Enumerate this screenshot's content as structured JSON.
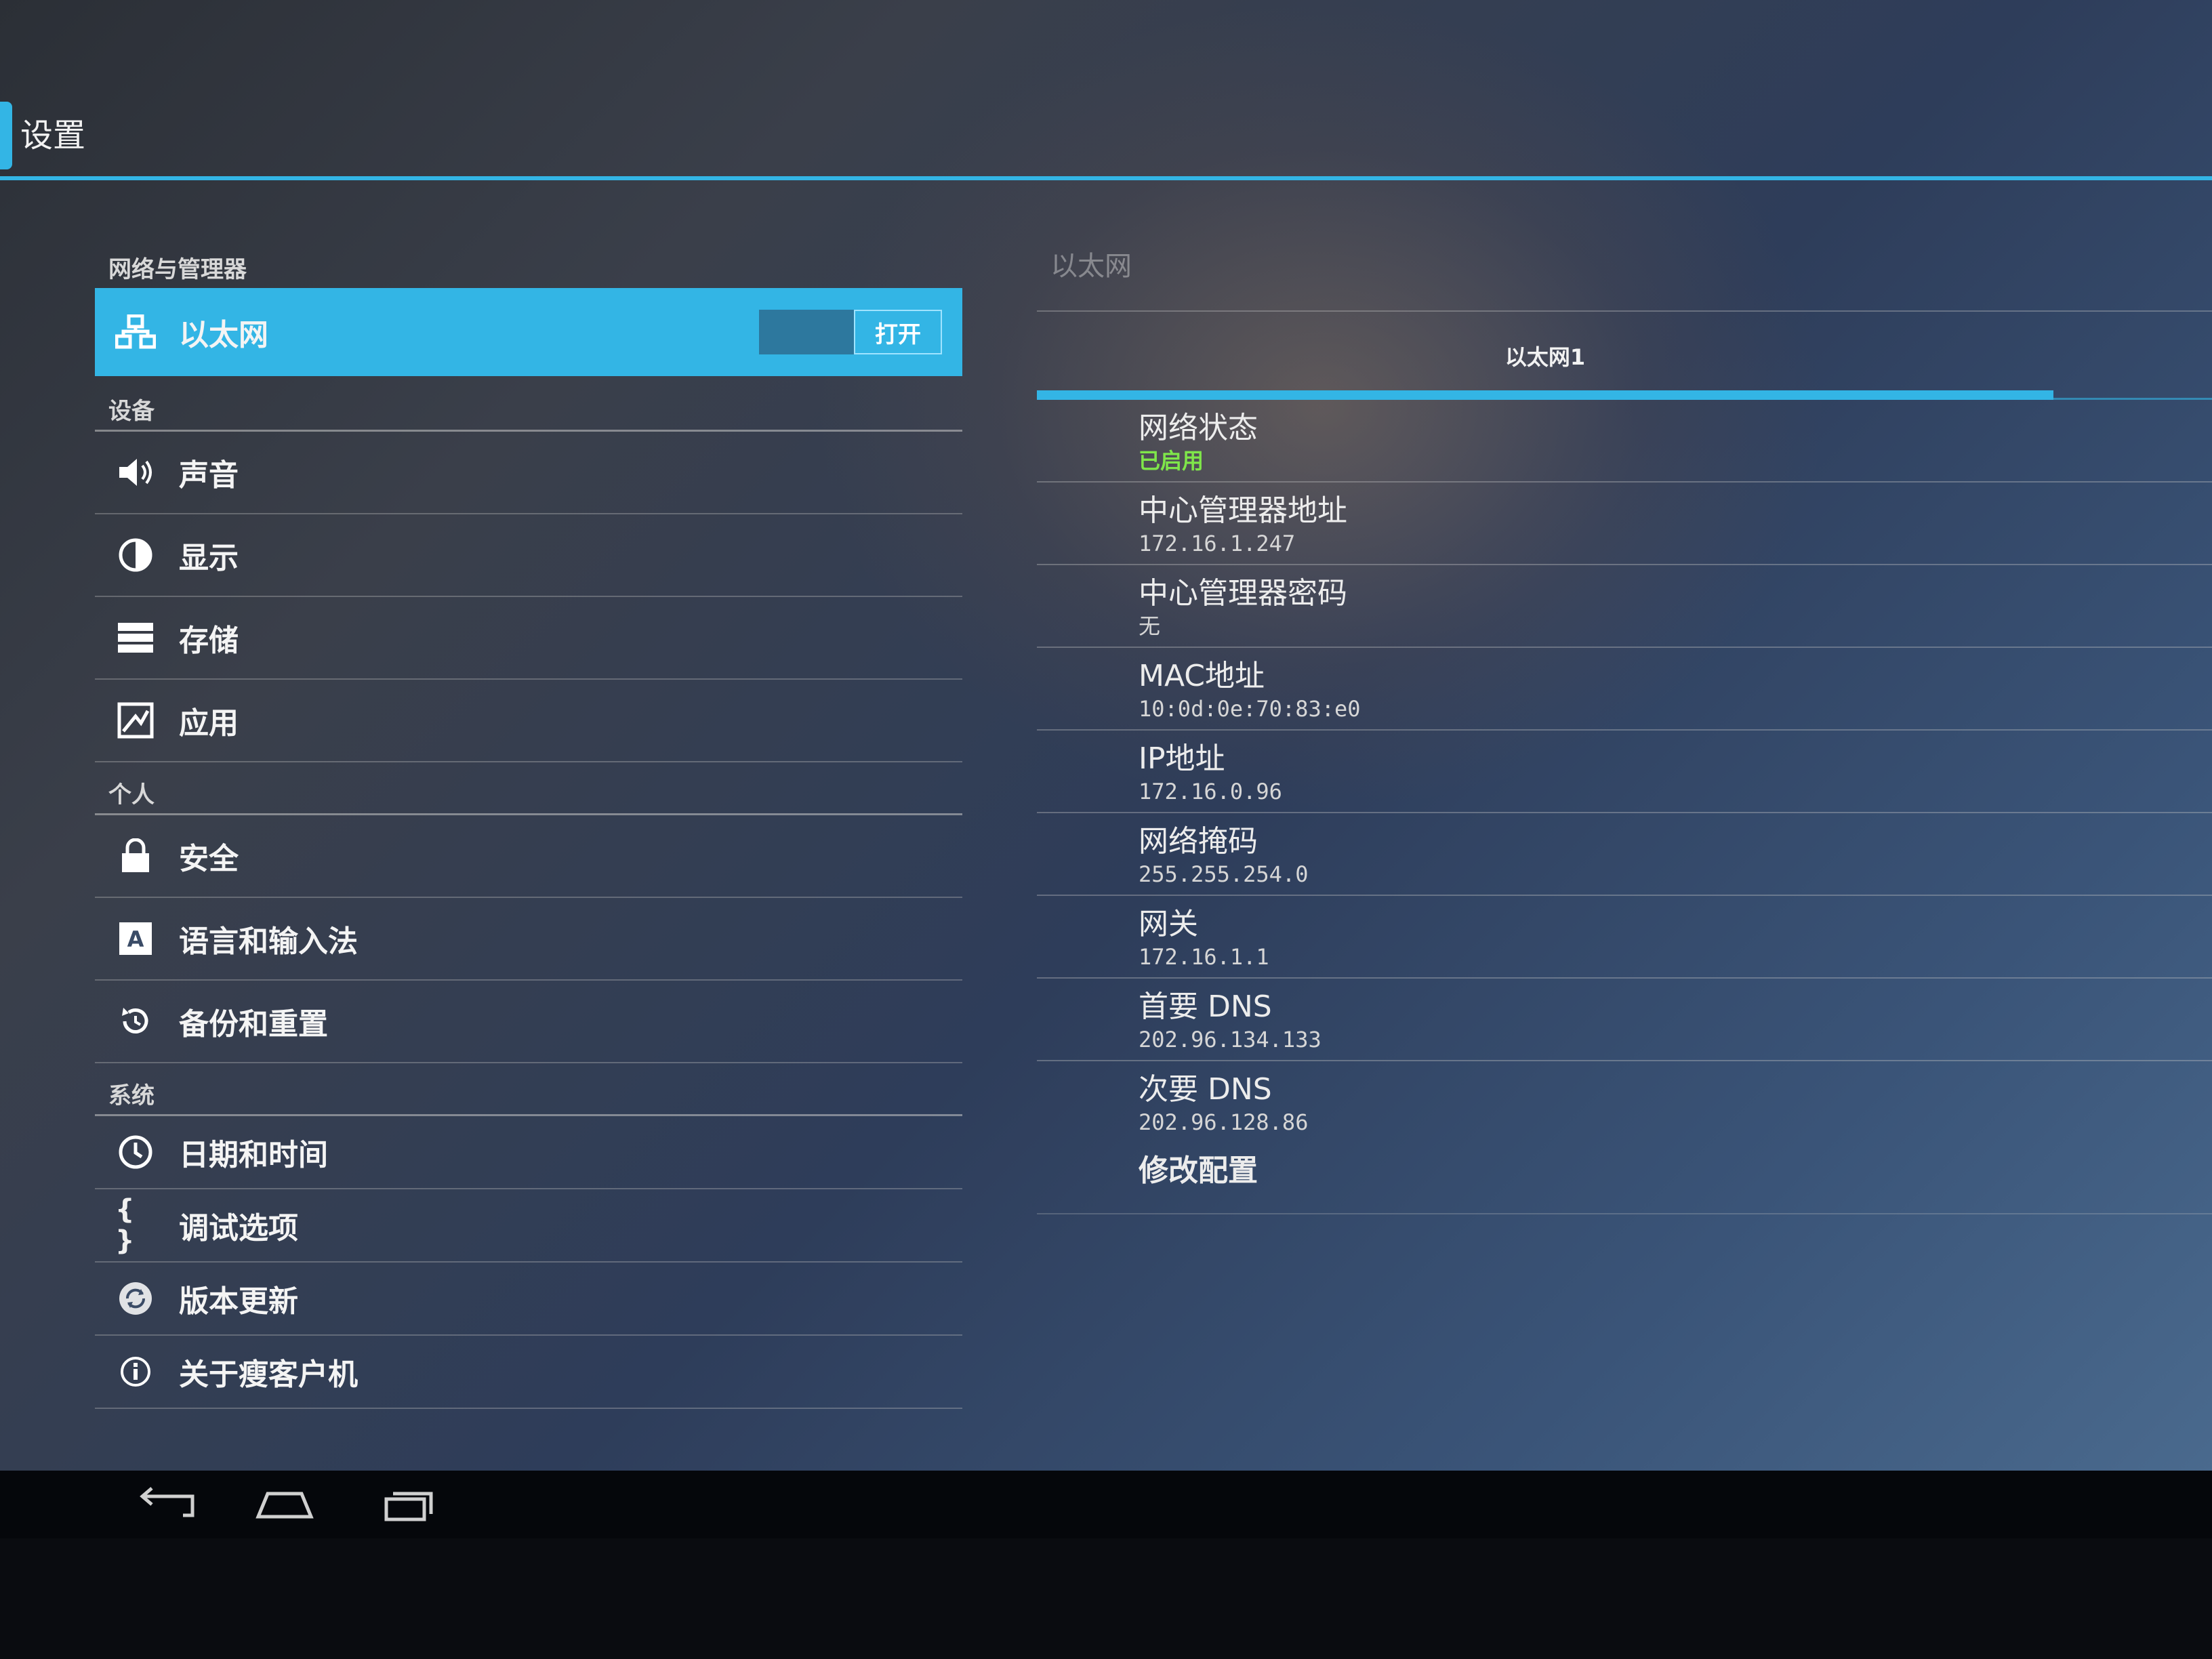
{
  "app": {
    "title": "设置"
  },
  "sidebar": {
    "sections": [
      {
        "header": "网络与管理器",
        "items": [
          {
            "label": "以太网",
            "icon": "ethernet-icon",
            "selected": true,
            "toggle_label": "打开"
          }
        ]
      },
      {
        "header": "设备",
        "items": [
          {
            "label": "声音",
            "icon": "volume-icon"
          },
          {
            "label": "显示",
            "icon": "brightness-icon"
          },
          {
            "label": "存储",
            "icon": "storage-icon"
          },
          {
            "label": "应用",
            "icon": "apps-icon"
          }
        ]
      },
      {
        "header": "个人",
        "items": [
          {
            "label": "安全",
            "icon": "lock-icon"
          },
          {
            "label": "语言和输入法",
            "icon": "keyboard-icon"
          },
          {
            "label": "备份和重置",
            "icon": "backup-icon"
          }
        ]
      },
      {
        "header": "系统",
        "items": [
          {
            "label": "日期和时间",
            "icon": "clock-icon"
          },
          {
            "label": "调试选项",
            "icon": "braces-icon"
          },
          {
            "label": "版本更新",
            "icon": "update-icon"
          },
          {
            "label": "关于瘦客户机",
            "icon": "info-icon"
          }
        ]
      }
    ]
  },
  "detail": {
    "breadcrumb": "以太网",
    "tab_label": "以太网1",
    "prefs": [
      {
        "title": "网络状态",
        "summary": "已启用",
        "status_color": "#7fe64a"
      },
      {
        "title": "中心管理器地址",
        "summary": "172.16.1.247"
      },
      {
        "title": "中心管理器密码",
        "summary": "无"
      },
      {
        "title": "MAC地址",
        "summary": "10:0d:0e:70:83:e0"
      },
      {
        "title": "IP地址",
        "summary": "172.16.0.96"
      },
      {
        "title": "网络掩码",
        "summary": "255.255.254.0"
      },
      {
        "title": "网关",
        "summary": "172.16.1.1"
      },
      {
        "title": "首要 DNS",
        "summary": "202.96.134.133"
      },
      {
        "title": "次要 DNS",
        "summary": "202.96.128.86"
      }
    ],
    "action_label": "修改配置"
  },
  "navbar": {
    "back_icon": "back-icon",
    "home_icon": "home-icon",
    "recents_icon": "recents-icon"
  },
  "colors": {
    "accent": "#33b5e5",
    "status_ok": "#7fe64a"
  }
}
